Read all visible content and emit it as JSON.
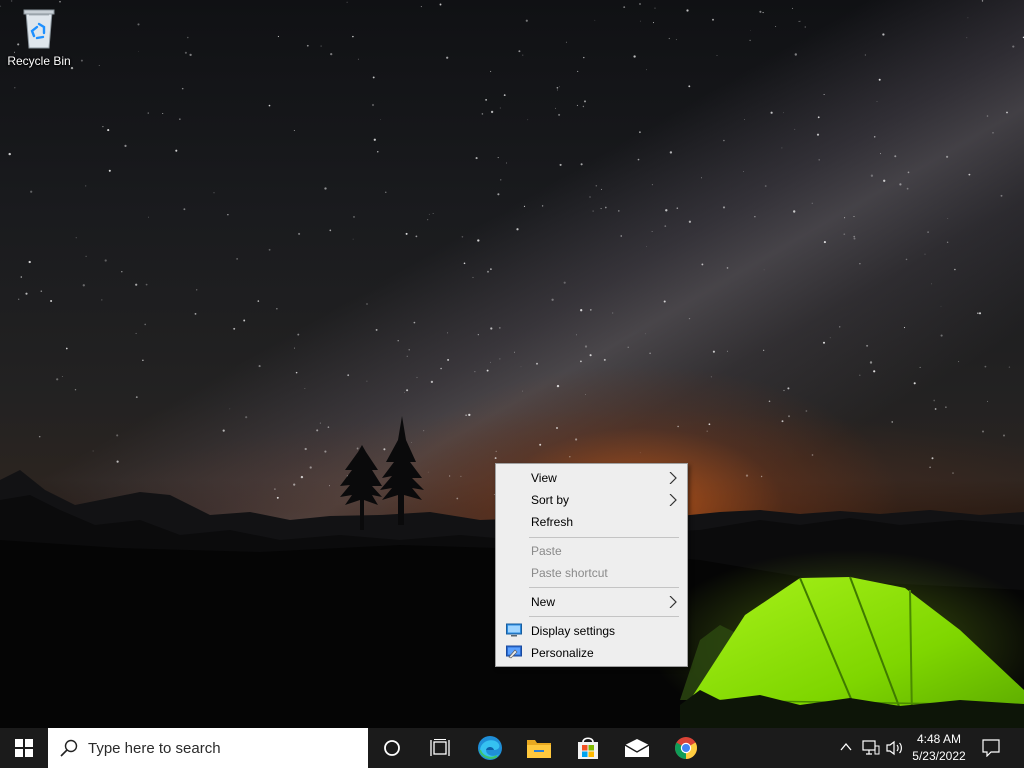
{
  "desktop": {
    "icons": [
      {
        "label": "Recycle Bin",
        "icon": "recycle-bin-icon"
      }
    ]
  },
  "context_menu": {
    "items": [
      {
        "label": "View",
        "submenu": true,
        "enabled": true
      },
      {
        "label": "Sort by",
        "submenu": true,
        "enabled": true
      },
      {
        "label": "Refresh",
        "submenu": false,
        "enabled": true
      },
      {
        "label": "Paste",
        "submenu": false,
        "enabled": false
      },
      {
        "label": "Paste shortcut",
        "submenu": false,
        "enabled": false
      },
      {
        "label": "New",
        "submenu": true,
        "enabled": true
      },
      {
        "label": "Display settings",
        "icon": "display-settings-icon",
        "enabled": true
      },
      {
        "label": "Personalize",
        "icon": "personalize-icon",
        "enabled": true
      }
    ]
  },
  "taskbar": {
    "search_placeholder": "Type here to search",
    "pinned": [
      "start-windows-icon",
      "cortana-circle-icon",
      "task-view-icon",
      "edge-icon",
      "file-explorer-icon",
      "microsoft-store-icon",
      "mail-icon",
      "chrome-icon"
    ],
    "tray": {
      "time": "4:48 AM",
      "date": "5/23/2022"
    }
  },
  "colors": {
    "taskbar_bg": "#1b1b1b",
    "menu_bg": "#eeeeee",
    "disabled_text": "#8a8a8a",
    "tent_green": "#8fe000"
  }
}
